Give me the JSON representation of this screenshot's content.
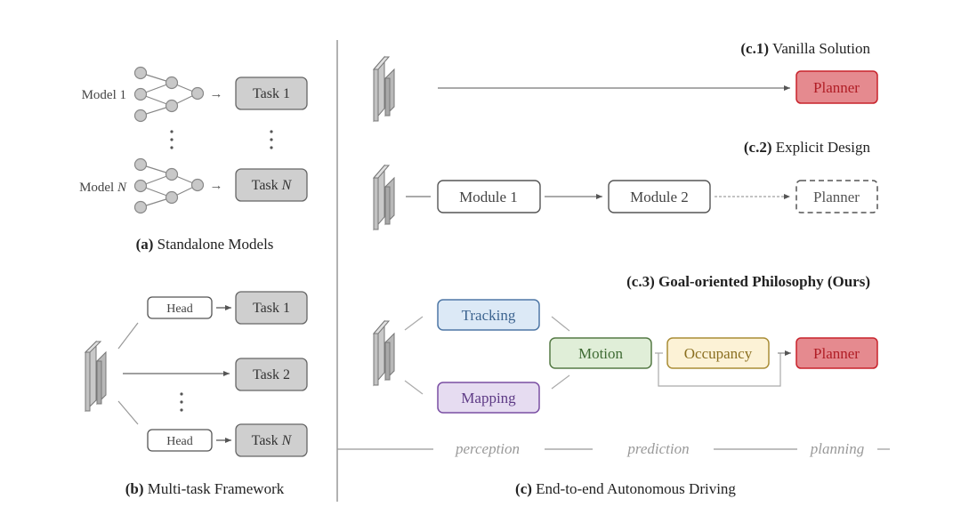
{
  "panel_a": {
    "caption_prefix": "(a)",
    "caption_text": " Standalone Models",
    "model1_label": "Model 1",
    "modelN_label_prefix": "Model ",
    "modelN_label_var": "N",
    "arrow": "→",
    "task1": "Task 1",
    "taskN_prefix": "Task ",
    "taskN_var": "N"
  },
  "panel_b": {
    "caption_prefix": "(b)",
    "caption_text": " Multi-task Framework",
    "head_label": "Head",
    "task1": "Task 1",
    "task2": "Task 2",
    "taskN_prefix": "Task ",
    "taskN_var": "N"
  },
  "panel_c": {
    "caption_prefix": "(c)",
    "caption_text": " End-to-end Autonomous Driving",
    "c1": {
      "title_prefix": "(c.1)",
      "title_text": " Vanilla Solution",
      "planner": "Planner"
    },
    "c2": {
      "title_prefix": "(c.2)",
      "title_text": " Explicit Design",
      "module1": "Module 1",
      "module2": "Module 2",
      "planner": "Planner"
    },
    "c3": {
      "title": "(c.3) Goal-oriented Philosophy (Ours)",
      "tracking": "Tracking",
      "mapping": "Mapping",
      "motion": "Motion",
      "occupancy": "Occupancy",
      "planner": "Planner"
    },
    "stages": [
      "perception",
      "prediction",
      "planning"
    ]
  },
  "colors": {
    "gray_box": "#cccccc",
    "planner_fill": "#e58a8f",
    "planner_stroke": "#c8232c",
    "planner_text": "#b01d25",
    "tracking_fill": "#dce9f6",
    "tracking_stroke": "#4e77a5",
    "mapping_fill": "#e6dcf1",
    "mapping_stroke": "#7a4ea3",
    "motion_fill": "#e0eed8",
    "motion_stroke": "#557a45",
    "occupancy_fill": "#fcf2d6",
    "occupancy_stroke": "#a98d36"
  }
}
